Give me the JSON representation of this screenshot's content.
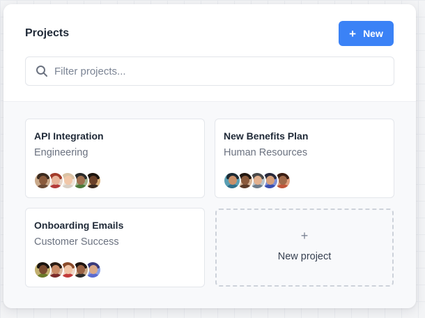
{
  "panel": {
    "title": "Projects",
    "new_button_label": "New",
    "new_button_icon": "plus-icon",
    "accent_color": "#3b82f6"
  },
  "search": {
    "placeholder": "Filter projects...",
    "value": "",
    "icon": "search-icon"
  },
  "projects": [
    {
      "title": "API Integration",
      "department": "Engineering",
      "avatars": [
        {
          "skin": "#8a5a3c",
          "hair": "#3b2a1f",
          "shirt": "#6b4a35",
          "bg": "#c9a98a"
        },
        {
          "skin": "#e8b49a",
          "hair": "#a23b2a",
          "shirt": "#b33a3a",
          "bg": "#e6d5c8"
        },
        {
          "skin": "#f1c7a8",
          "hair": "#d9c3a5",
          "shirt": "#d8cfc4",
          "bg": "#efe6dc"
        },
        {
          "skin": "#a0704f",
          "hair": "#2b2b2b",
          "shirt": "#4d7a3a",
          "bg": "#9fb08a"
        },
        {
          "skin": "#6b4129",
          "hair": "#1c140e",
          "shirt": "#3a2a20",
          "bg": "#d9b07a"
        }
      ]
    },
    {
      "title": "New Benefits Plan",
      "department": "Human Resources",
      "avatars": [
        {
          "skin": "#c9906a",
          "hair": "#1e2a33",
          "shirt": "#2f6f8a",
          "bg": "#5a9fb3"
        },
        {
          "skin": "#8a5a3c",
          "hair": "#221812",
          "shirt": "#5a3a28",
          "bg": "#d7b79a"
        },
        {
          "skin": "#e2b08e",
          "hair": "#4a4a4a",
          "shirt": "#6d7c8a",
          "bg": "#b8c4cc"
        },
        {
          "skin": "#d7a07c",
          "hair": "#2a2a3a",
          "shirt": "#3a4fb0",
          "bg": "#7f8fd6"
        },
        {
          "skin": "#a0694a",
          "hair": "#3a1e14",
          "shirt": "#c0553a",
          "bg": "#e0a080"
        }
      ]
    },
    {
      "title": "Onboarding Emails",
      "department": "Customer Success",
      "avatars": [
        {
          "skin": "#7a4b30",
          "hair": "#1a1410",
          "shirt": "#6a7a2a",
          "bg": "#c2b070"
        },
        {
          "skin": "#c98a66",
          "hair": "#2a1c14",
          "shirt": "#7a2a2a",
          "bg": "#d9b8a0"
        },
        {
          "skin": "#f0c4a6",
          "hair": "#8a4a2a",
          "shirt": "#c23a3a",
          "bg": "#f0d8c8"
        },
        {
          "skin": "#9a6244",
          "hair": "#1e1410",
          "shirt": "#2a2a2a",
          "bg": "#c8a888"
        },
        {
          "skin": "#d9a888",
          "hair": "#3a3a7a",
          "shirt": "#5a6ad0",
          "bg": "#8aa0e6"
        }
      ]
    }
  ],
  "new_project": {
    "plus_glyph": "+",
    "label": "New project"
  }
}
